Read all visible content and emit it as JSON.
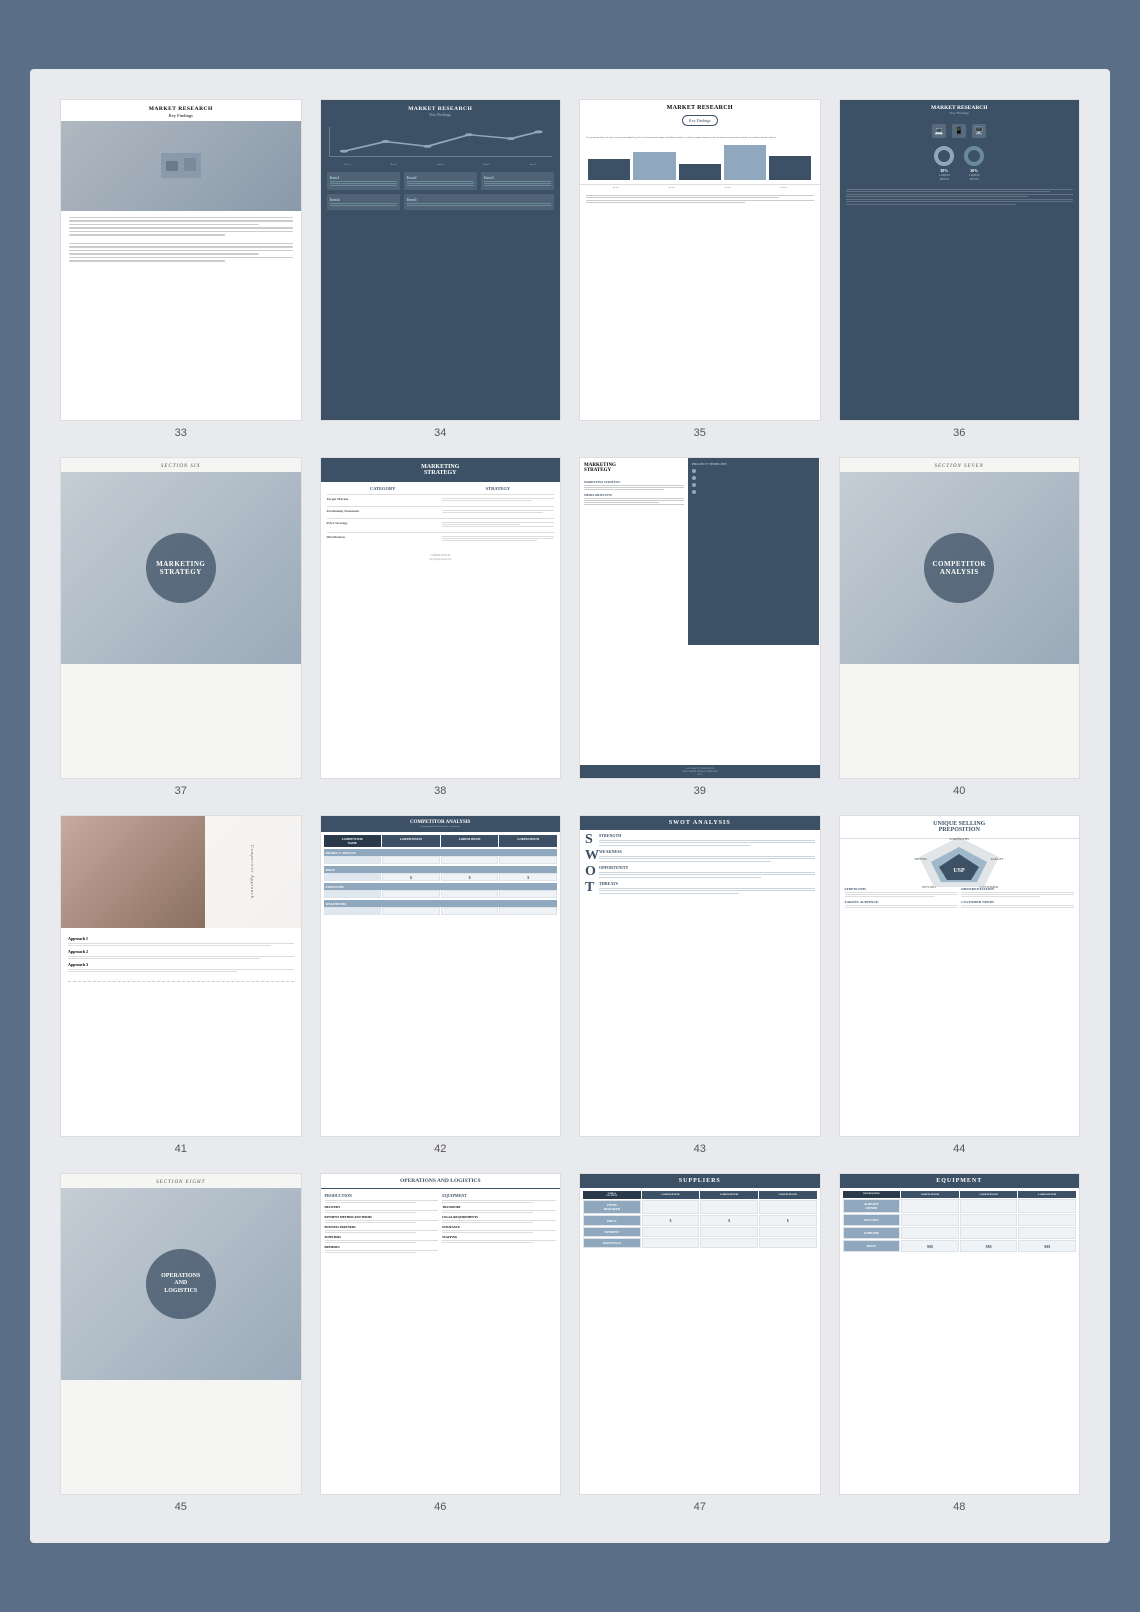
{
  "slides": [
    {
      "number": 33,
      "type": "market-research-text",
      "title": "MARKET RESEARCH",
      "subtitle": "Key Findings"
    },
    {
      "number": 34,
      "type": "market-research-dark",
      "title": "MARKET RESEARCH",
      "subtitle": "Key Findings",
      "items": [
        "Item1",
        "Item2",
        "Item3",
        "Item4",
        "Item5"
      ]
    },
    {
      "number": 35,
      "type": "market-research-bar",
      "title": "MARKET RESEARCH",
      "badge": "Key Findings"
    },
    {
      "number": 36,
      "type": "market-research-donut",
      "title": "MARKET RESEARCH",
      "subtitle": "Key Findings",
      "donut1": {
        "pct": "38%",
        "label": "LOREM\nIPSUM"
      },
      "donut2": {
        "pct": "20%",
        "label": "LOREM\nIPSUM"
      }
    },
    {
      "number": 37,
      "type": "section-six",
      "section": "SECTION SIX",
      "heading": "MARKETING\nSTRATEGY"
    },
    {
      "number": 38,
      "type": "marketing-strategy-table",
      "title": "MARKETING\nSTRATEGY",
      "col1": "CATEGORY",
      "col2": "STRATEGY",
      "rows": [
        "Target Market",
        "Positioning Statement",
        "Price Strategy",
        "Distribution"
      ]
    },
    {
      "number": 39,
      "type": "marketing-strategy-split",
      "leftTitle": "MARKETING\nSTRATEGY",
      "rightTitle": "PROJECT TIMELINE"
    },
    {
      "number": 40,
      "type": "section-seven",
      "section": "SECTION SEVEN",
      "heading": "COMPETITOR\nANALYSIS"
    },
    {
      "number": 41,
      "type": "competitor-approach",
      "sideText": "Competitor Approach",
      "items": [
        "Approach 1",
        "Approach 2",
        "Approach 3"
      ]
    },
    {
      "number": 42,
      "type": "competitor-analysis-table",
      "title": "COMPETITOR ANALYSIS",
      "cols": [
        "COMPETITOR NAME",
        "LOREM IPSUM",
        "LOREM IPSUM",
        "LOREM IPSUM"
      ],
      "rows": [
        "PRODUCT / SERVICE",
        "PRICE",
        "STRENGTHS",
        "WEAKNESSES"
      ]
    },
    {
      "number": 43,
      "type": "swot",
      "title": "SWOT ANALYSIS",
      "letters": [
        "S",
        "W",
        "O",
        "T"
      ],
      "labels": [
        "STRENGTH",
        "WEAKNESS",
        "OPPORTUNITY",
        "THREATS"
      ]
    },
    {
      "number": 44,
      "type": "usp",
      "title": "UNIQUE SELLING\nPREPOSITION",
      "center": "USP",
      "corners": [
        "STRENGTHS",
        "DIFFERENTIATION",
        "TARGET AUDIENCE",
        "BUYING DECISION",
        "CUSTOMER NEEDS"
      ]
    },
    {
      "number": 45,
      "type": "section-eight",
      "section": "SECTION EIGHT",
      "heading": "OPERATIONS\nAND\nLOGISTICS"
    },
    {
      "number": 46,
      "type": "operations-logistics",
      "title": "OPERATIONS AND LOGISTICS",
      "col1": "PRODUCTION",
      "col2": "EQUIPMENT",
      "rows1": [
        "DELIVERY",
        "PAYMENT METHOD AND TERMS",
        "BUSINESS PARTNERS",
        "SUPPLIERS",
        "PREMISES"
      ],
      "rows2": [
        "TRANSPORT",
        "LEGAL REQUIREMENTS",
        "INSURANCE",
        "STAFFING"
      ]
    },
    {
      "number": 47,
      "type": "suppliers",
      "title": "SUPPLIERS",
      "cols": [
        "NAME &\nLOCATION",
        "LOREM IPSUM",
        "LOREM IPSUM",
        "LOREM IPSUM"
      ],
      "rows": [
        "ITEMS\nREQUIRED",
        "PRICE",
        "PAYMENT",
        "RATIONALE"
      ],
      "dollar": "$"
    },
    {
      "number": 48,
      "type": "equipment",
      "title": "EQUIPMENT",
      "cols": [
        "ITEM REQUIRED",
        "LOREM IPSUM",
        "LOREM IPSUM",
        "LOREM IPSUM"
      ],
      "rows": [
        "ALREADY\nOWNED",
        "NON-USES",
        "SUPPLIER",
        "PRICE"
      ],
      "dollar": "$$$"
    }
  ]
}
